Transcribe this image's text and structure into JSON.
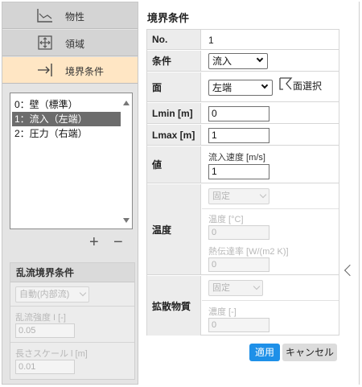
{
  "nav": {
    "tabs": [
      {
        "label": "物性",
        "icon": "graph-icon"
      },
      {
        "label": "領域",
        "icon": "move-arrows-icon"
      },
      {
        "label": "境界条件",
        "icon": "arrow-to-wall-icon"
      }
    ],
    "active_index": 2
  },
  "boundary_list": {
    "items": [
      "0：壁（標準）",
      "1：流入（左端）",
      "2：圧力（右端）"
    ],
    "selected_index": 1,
    "add_label": "+",
    "remove_label": "−"
  },
  "turbulence": {
    "title": "乱流境界条件",
    "mode_value": "自動(内部流)",
    "intensity_label": "乱流強度 I [-]",
    "intensity_value": "0.05",
    "length_label": "長さスケール l [m]",
    "length_value": "0.01"
  },
  "detail": {
    "title": "境界条件",
    "no_label": "No.",
    "no_value": "1",
    "condition_label": "条件",
    "condition_value": "流入",
    "face_label": "面",
    "face_value": "左端",
    "face_select_label": "面選択",
    "lmin_label": "Lmin [m]",
    "lmin_value": "0",
    "lmax_label": "Lmax [m]",
    "lmax_value": "1",
    "value_label": "値",
    "velocity_label": "流入速度 [m/s]",
    "velocity_value": "1",
    "temp_label": "温度",
    "temp_mode": "固定",
    "temp_unit_label": "温度 [°C]",
    "temp_value": "0",
    "heat_label": "熱伝達率 [W/(m2 K)]",
    "heat_value": "0",
    "diff_label": "拡散物質",
    "diff_mode": "固定",
    "conc_label": "濃度 [-]",
    "conc_value": "0"
  },
  "actions": {
    "apply_label": "適用",
    "cancel_label": "キャンセル"
  },
  "colors": {
    "active_tab": "#ffe6c4",
    "apply_button": "#1e90e8",
    "selected_item": "#6c6c6c"
  }
}
